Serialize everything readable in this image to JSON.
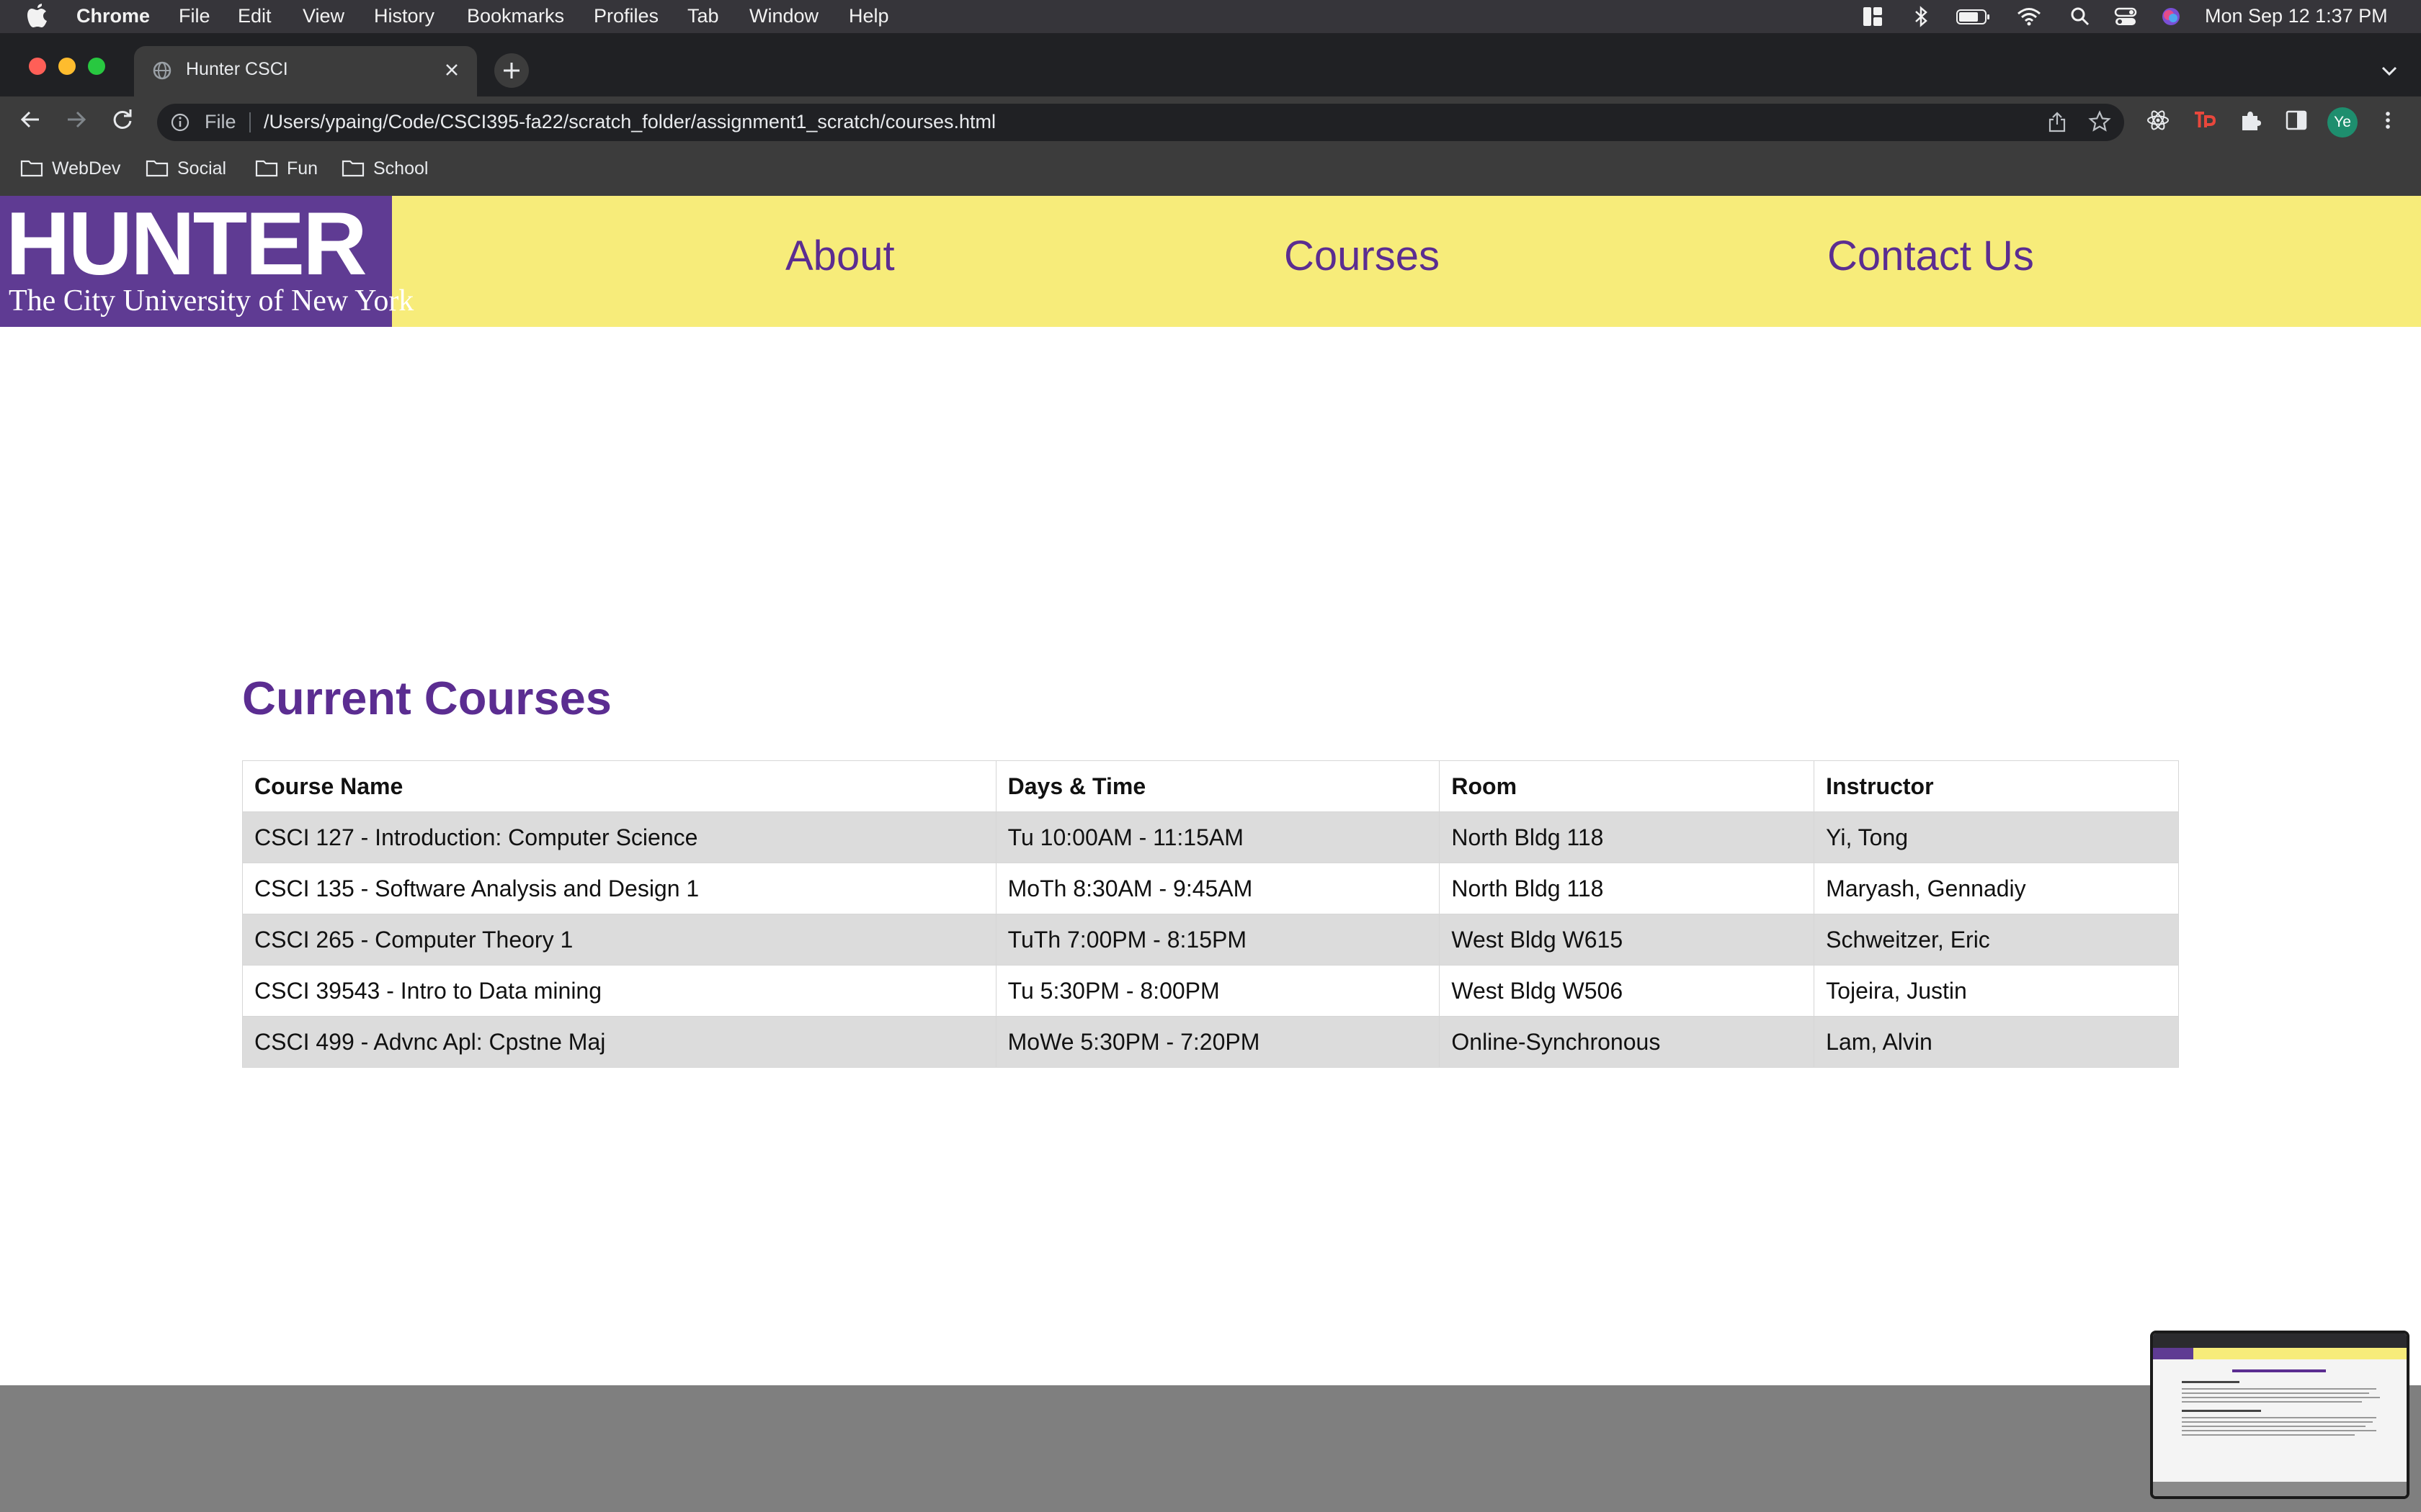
{
  "menubar": {
    "app_name": "Chrome",
    "menus": [
      "File",
      "Edit",
      "View",
      "History",
      "Bookmarks",
      "Profiles",
      "Tab",
      "Window",
      "Help"
    ],
    "datetime": "Mon Sep 12  1:37 PM"
  },
  "browser": {
    "tab_title": "Hunter CSCI",
    "url_scheme_label": "File",
    "url": "/Users/ypaing/Code/CSCI395-fa22/scratch_folder/assignment1_scratch/courses.html",
    "profile_initials": "Ye",
    "bookmarks": [
      "WebDev",
      "Social",
      "Fun",
      "School"
    ]
  },
  "site": {
    "logo_text": "HUNTER",
    "logo_subtitle": "The City University of New York",
    "nav": [
      "About",
      "Courses",
      "Contact Us"
    ],
    "heading": "Current Courses",
    "table": {
      "headers": [
        "Course Name",
        "Days & Time",
        "Room",
        "Instructor"
      ],
      "rows": [
        [
          "CSCI 127 - Introduction: Computer Science",
          "Tu 10:00AM - 11:15AM",
          "North Bldg 118",
          "Yi, Tong"
        ],
        [
          "CSCI 135 - Software Analysis and Design 1",
          "MoTh 8:30AM - 9:45AM",
          "North Bldg 118",
          "Maryash, Gennadiy"
        ],
        [
          "CSCI 265 - Computer Theory 1",
          "TuTh 7:00PM - 8:15PM",
          "West Bldg W615",
          "Schweitzer, Eric"
        ],
        [
          "CSCI 39543 - Intro to Data mining",
          "Tu 5:30PM - 8:00PM",
          "West Bldg W506",
          "Tojeira, Justin"
        ],
        [
          "CSCI 499 - Advnc Apl: Cpstne Maj",
          "MoWe 5:30PM - 7:20PM",
          "Online-Synchronous",
          "Lam, Alvin"
        ]
      ]
    }
  },
  "colors": {
    "header_yellow": "#f7ec7a",
    "brand_purple": "#5b2d91",
    "logo_purple": "#5f3b93",
    "footer_gray": "#7f7f7f"
  }
}
